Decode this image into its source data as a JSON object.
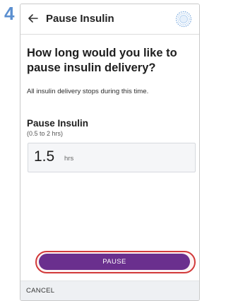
{
  "step": {
    "number": "4"
  },
  "header": {
    "title": "Pause Insulin",
    "back_icon": "arrow-left-icon",
    "status_icon": "pod-status-icon"
  },
  "content": {
    "question": "How long would you like to pause insulin delivery?",
    "info": "All insulin delivery stops during this time.",
    "field_label": "Pause Insulin",
    "range_hint": "(0.5 to 2 hrs)",
    "value": "1.5",
    "unit": "hrs"
  },
  "actions": {
    "pause_label": "PAUSE",
    "cancel_label": "CANCEL"
  },
  "colors": {
    "accent": "#6a2f8e",
    "highlight": "#d23a3a",
    "step_number": "#5b8fd0"
  }
}
